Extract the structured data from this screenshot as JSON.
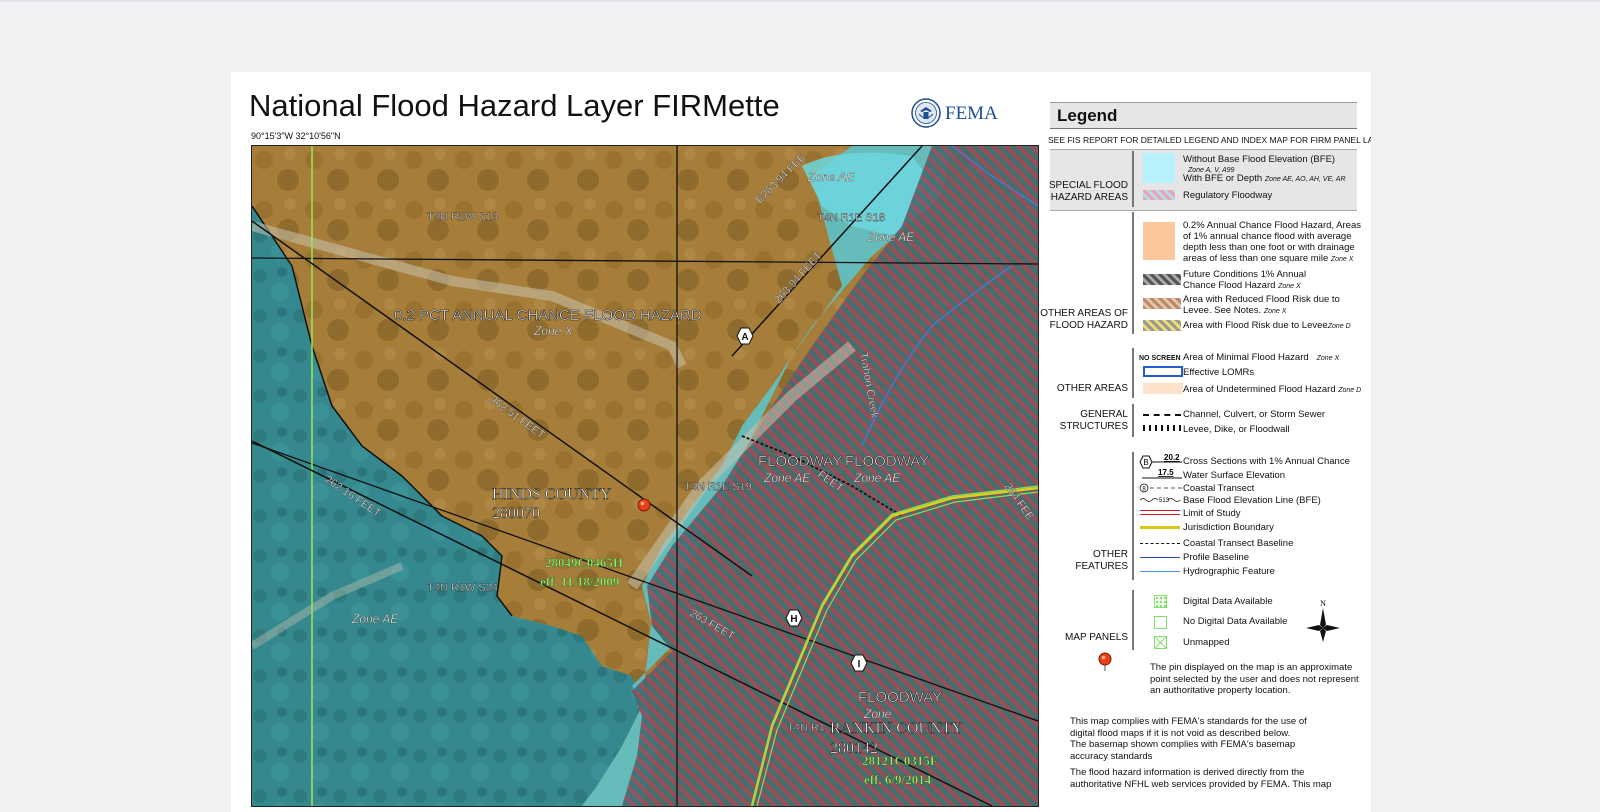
{
  "title": "National Flood Hazard Layer FIRMette",
  "coordinates": "90°15'3\"W 32°10'56\"N",
  "logo": {
    "text": "FEMA"
  },
  "map": {
    "labels": {
      "sec_t4n_r1w_s13": "T4N R1W S13",
      "sec_t4n_r1e_s18": "T4N R1E S18",
      "sec_t4n_r1e_s19": "T4N R1E S19",
      "sec_t4n_r1w_s24": "T4N R1W S24",
      "sec_t4n_r1": "T4N R1",
      "zone_ae_1": "Zone AE",
      "zone_ae_2": "Zone AE",
      "zone_ae_3": "Zone AE",
      "zone_ae_4": "Zone AE",
      "zone_x": "Zone X",
      "zone_partial": "Zone",
      "pct_flood": "0.2 PCT ANNUAL CHANCE FLOOD HAZARD",
      "floodway_1": "FLOODWAY",
      "floodway_2": "FLOODWAY",
      "floodway_3": "FLOODWAY",
      "hinds_county": "HINDS COUNTY",
      "hinds_code": "280070",
      "rankin_county": "RANKIN COUNTY",
      "rankin_code": "280142",
      "panel_1_id": "28049C0465H",
      "panel_1_eff": "eff. 11/18/2009",
      "panel_2_id": "28121C0315F",
      "panel_2_eff": "eff. 6/9/2014",
      "bfe_26294": "E263.94 FEE",
      "bfe_26394": "263.94 FEET",
      "bfe_26251": "262.51 FEET",
      "bfe_26216": "262.16 FEET",
      "bfe_263": "263 FEET",
      "bfe_feet_1": "FEET",
      "bfe_feet_2": "264 FEE",
      "creek": "Trahon Creek"
    },
    "xsections": [
      "A",
      "H",
      "I"
    ]
  },
  "legend": {
    "title": "Legend",
    "subtitle": "SEE FIS REPORT FOR DETAILED LEGEND AND INDEX MAP FOR FIRM PANEL LAYOUT",
    "categories": {
      "special": [
        "SPECIAL FLOOD",
        "HAZARD AREAS"
      ],
      "other_areas_hazard": [
        "OTHER AREAS OF",
        "FLOOD HAZARD"
      ],
      "other_areas": "OTHER AREAS",
      "general": [
        "GENERAL",
        "STRUCTURES"
      ],
      "other_features": [
        "OTHER",
        "FEATURES"
      ],
      "map_panels": "MAP PANELS"
    },
    "items": {
      "without_bfe": "Without Base Flood Elevation (BFE)",
      "without_bfe_zone": "Zone A, V, A99",
      "with_bfe": "With BFE or Depth",
      "with_bfe_zone": "Zone AE, AO, AH, VE, AR",
      "reg_floodway": "Regulatory Floodway",
      "pct02_line1": "0.2% Annual Chance Flood Hazard, Areas",
      "pct02_line2": "of 1% annual chance flood with average",
      "pct02_line3": "depth less than one foot or with drainage",
      "pct02_line4": "areas of less than one square mile",
      "pct02_zone": "Zone X",
      "future_line1": "Future Conditions 1% Annual",
      "future_line2": "Chance Flood Hazard",
      "future_zone": "Zone X",
      "reduced_line1": "Area with Reduced Flood Risk due to",
      "reduced_line2": "Levee. See Notes.",
      "reduced_zone": "Zone X",
      "levee_risk": "Area with Flood Risk due to Levee",
      "levee_risk_zone": "Zone D",
      "no_screen": "NO SCREEN",
      "minimal": "Area of Minimal Flood Hazard",
      "minimal_zone": "Zone X",
      "lomrs": "Effective LOMRs",
      "undetermined": "Area of Undetermined Flood Hazard",
      "undetermined_zone": "Zone D",
      "channel": "Channel, Culvert, or Storm Sewer",
      "levee": "Levee, Dike, or Floodwall",
      "xsec_val": "20.2",
      "xsec_letter": "B",
      "xsec": "Cross Sections with 1% Annual Chance",
      "wse_val": "17.5",
      "wse": "Water Surface Elevation",
      "coastal_letter": "8",
      "coastal": "Coastal Transect",
      "bfe_line_num": "513",
      "bfe_line": "Base Flood Elevation Line (BFE)",
      "limit": "Limit of Study",
      "jurisdiction": "Jurisdiction Boundary",
      "coastal_baseline": "Coastal Transect Baseline",
      "profile_baseline": "Profile Baseline",
      "hydro": "Hydrographic Feature",
      "digital": "Digital Data Available",
      "no_digital": "No Digital Data Available",
      "unmapped": "Unmapped",
      "north": "N"
    },
    "pin_note": [
      "The pin displayed on the map is an approximate",
      "point selected by the user and does not represent",
      "an authoritative property location."
    ],
    "compliance": [
      "This map complies with FEMA's standards for the use of",
      "digital flood maps if it is not void as described below.",
      "The basemap shown complies with FEMA's basemap",
      "accuracy standards"
    ],
    "nfhl": [
      "The flood hazard information is derived directly from the",
      "authoritative NFHL web services provided by FEMA. This map"
    ]
  },
  "colors": {
    "zone_ae": "#6fd3dc",
    "zone_x": "#f0b47a",
    "floodway_hatch": "#d0505a",
    "jurisdiction": "#d8d21c",
    "hydro": "#3f7ee8",
    "lomr": "#1f5fd0",
    "panel_green": "#7fe06a"
  }
}
